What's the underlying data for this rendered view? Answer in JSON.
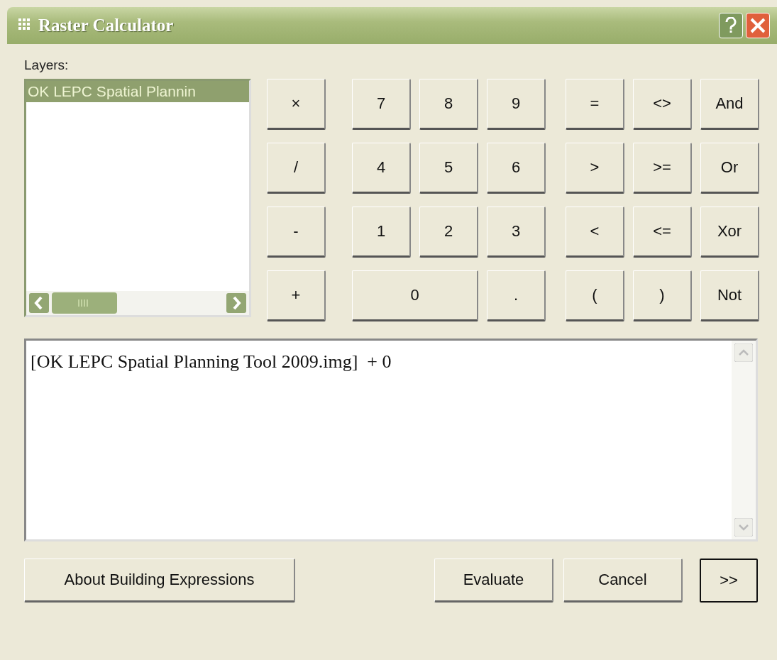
{
  "window": {
    "title": "Raster Calculator"
  },
  "layers": {
    "label": "Layers:",
    "items": [
      {
        "text": "OK LEPC Spatial Plannin",
        "selected": true
      }
    ]
  },
  "keypad": {
    "operators": [
      "×",
      "/",
      "-",
      "+"
    ],
    "digits": [
      [
        {
          "text": "7"
        },
        {
          "text": "8"
        },
        {
          "text": "9"
        }
      ],
      [
        {
          "text": "4"
        },
        {
          "text": "5"
        },
        {
          "text": "6"
        }
      ],
      [
        {
          "text": "1"
        },
        {
          "text": "2"
        },
        {
          "text": "3"
        }
      ],
      [
        {
          "text": "0",
          "wide": true
        },
        {
          "text": "."
        }
      ]
    ],
    "logic": [
      [
        "=",
        "<>",
        "And"
      ],
      [
        ">",
        ">=",
        "Or"
      ],
      [
        "<",
        "<=",
        "Xor"
      ],
      [
        "(",
        ")",
        "Not"
      ]
    ]
  },
  "expression": {
    "value": "[OK LEPC Spatial Planning Tool 2009.img]  + 0"
  },
  "buttons": [
    {
      "label": "About Building Expressions",
      "default": false
    },
    {
      "label": "Evaluate",
      "default": false
    },
    {
      "label": "Cancel",
      "default": false
    },
    {
      "label": ">>",
      "default": true
    }
  ]
}
